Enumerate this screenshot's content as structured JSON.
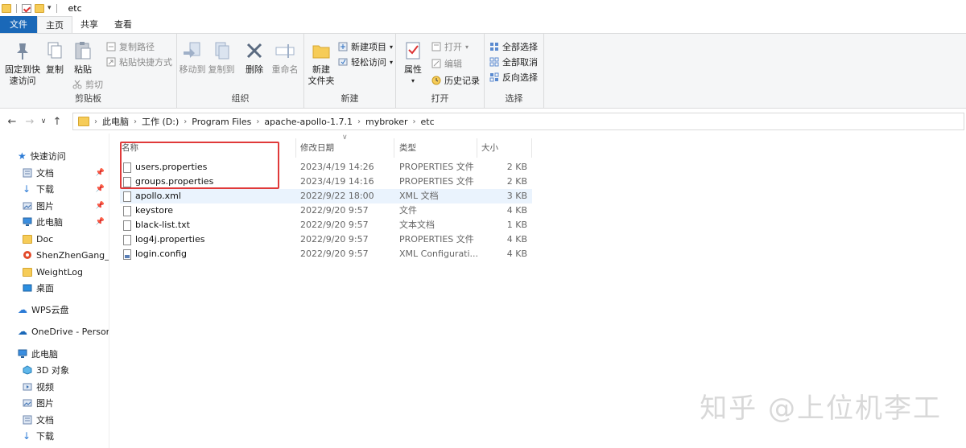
{
  "window": {
    "title": "etc"
  },
  "tabs": [
    {
      "label": "文件"
    },
    {
      "label": "主页"
    },
    {
      "label": "共享"
    },
    {
      "label": "查看"
    }
  ],
  "ribbon": {
    "clipboard": {
      "pin_label": "固定到快\n速访问",
      "copy_label": "复制",
      "paste_label": "粘贴",
      "copy_path_label": "复制路径",
      "paste_shortcut_label": "粘贴快捷方式",
      "cut_label": "剪切",
      "group_label": "剪贴板"
    },
    "organize": {
      "move_label": "移动到",
      "copyto_label": "复制到",
      "delete_label": "删除",
      "rename_label": "重命名",
      "group_label": "组织"
    },
    "new": {
      "newfolder_label": "新建\n文件夹",
      "newitem_label": "新建项目",
      "easyaccess_label": "轻松访问",
      "group_label": "新建"
    },
    "open": {
      "properties_label": "属性",
      "open_label": "打开",
      "edit_label": "编辑",
      "history_label": "历史记录",
      "group_label": "打开"
    },
    "select": {
      "selectall_label": "全部选择",
      "selectnone_label": "全部取消",
      "invert_label": "反向选择",
      "group_label": "选择"
    }
  },
  "address": {
    "crumbs": [
      "此电脑",
      "工作 (D:)",
      "Program Files",
      "apache-apollo-1.7.1",
      "mybroker",
      "etc"
    ]
  },
  "sidebar": {
    "items": [
      {
        "label": "快速访问"
      },
      {
        "label": "文档"
      },
      {
        "label": "下载"
      },
      {
        "label": "图片"
      },
      {
        "label": "此电脑"
      },
      {
        "label": "Doc"
      },
      {
        "label": "ShenZhenGang_YU"
      },
      {
        "label": "WeightLog"
      },
      {
        "label": "桌面"
      },
      {
        "label": "WPS云盘"
      },
      {
        "label": "OneDrive - Persona"
      },
      {
        "label": "此电脑"
      },
      {
        "label": "3D 对象"
      },
      {
        "label": "视频"
      },
      {
        "label": "图片"
      },
      {
        "label": "文档"
      },
      {
        "label": "下载"
      }
    ]
  },
  "columns": {
    "name": "名称",
    "date": "修改日期",
    "type": "类型",
    "size": "大小"
  },
  "files": [
    {
      "name": "users.properties",
      "date": "2023/4/19 14:26",
      "type": "PROPERTIES 文件",
      "size": "2 KB"
    },
    {
      "name": "groups.properties",
      "date": "2023/4/19 14:16",
      "type": "PROPERTIES 文件",
      "size": "2 KB"
    },
    {
      "name": "apollo.xml",
      "date": "2022/9/22 18:00",
      "type": "XML 文档",
      "size": "3 KB"
    },
    {
      "name": "keystore",
      "date": "2022/9/20 9:57",
      "type": "文件",
      "size": "4 KB"
    },
    {
      "name": "black-list.txt",
      "date": "2022/9/20 9:57",
      "type": "文本文档",
      "size": "1 KB"
    },
    {
      "name": "log4j.properties",
      "date": "2022/9/20 9:57",
      "type": "PROPERTIES 文件",
      "size": "4 KB"
    },
    {
      "name": "login.config",
      "date": "2022/9/20 9:57",
      "type": "XML Configurati...",
      "size": "4 KB"
    }
  ],
  "watermark": "知乎 @上位机李工",
  "colors": {
    "accent": "#1a68b8",
    "highlight_box": "#e03a3a",
    "selected_row": "#eaf3fd"
  }
}
